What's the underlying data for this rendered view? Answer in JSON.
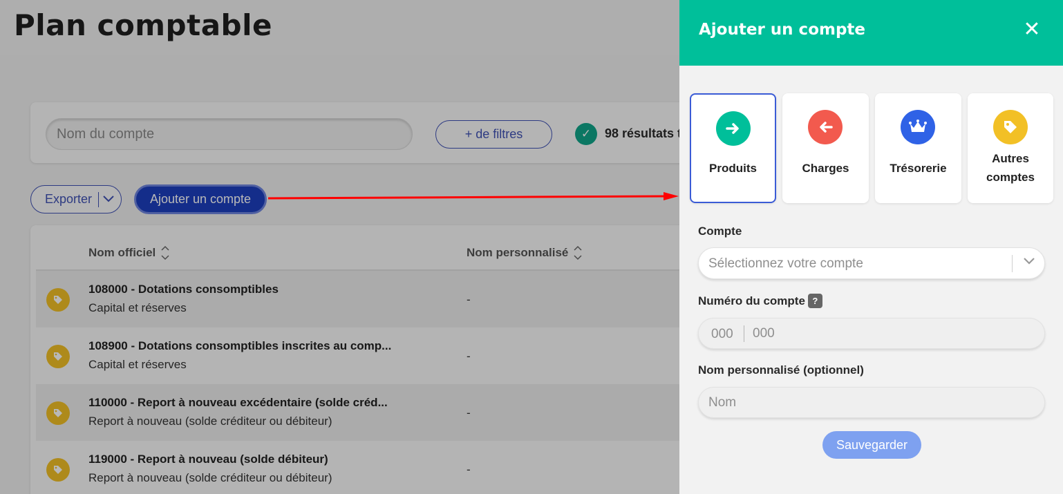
{
  "page": {
    "title": "Plan comptable",
    "search_placeholder": "Nom du compte",
    "filters_label": "+ de filtres",
    "results_text": "98 résultats t",
    "export_label": "Exporter",
    "add_account_label": "Ajouter un compte"
  },
  "table": {
    "columns": [
      "Nom officiel",
      "Nom personnalisé"
    ],
    "rows": [
      {
        "title": "108000 - Dotations consomptibles",
        "category": "Capital et réserves",
        "custom_name": "-"
      },
      {
        "title": "108900 - Dotations consomptibles inscrites au comp...",
        "category": "Capital et réserves",
        "custom_name": "-"
      },
      {
        "title": "110000 - Report à nouveau excédentaire (solde créd...",
        "category": "Report à nouveau (solde créditeur ou débiteur)",
        "custom_name": "-"
      },
      {
        "title": "119000 - Report à nouveau (solde débiteur)",
        "category": "Report à nouveau (solde créditeur ou débiteur)",
        "custom_name": "-"
      }
    ]
  },
  "panel": {
    "title": "Ajouter un compte",
    "close_icon": "close-icon",
    "types": [
      {
        "label": "Produits",
        "icon": "arrow-right-icon",
        "color": "#00bf9a",
        "selected": true
      },
      {
        "label": "Charges",
        "icon": "arrow-left-icon",
        "color": "#f25a4e",
        "selected": false
      },
      {
        "label": "Trésorerie",
        "icon": "crown-icon",
        "color": "#2f62e6",
        "selected": false
      },
      {
        "label": "Autres comptes",
        "icon": "tag-icon",
        "color": "#f2c026",
        "selected": false
      }
    ],
    "account_label": "Compte",
    "account_placeholder": "Sélectionnez votre compte",
    "number_label": "Numéro du compte",
    "help_badge": "?",
    "number_prefix": "000",
    "number_placeholder": "000",
    "custom_name_label": "Nom personnalisé (optionnel)",
    "custom_name_placeholder": "Nom",
    "save_label": "Sauvegarder"
  },
  "colors": {
    "accent": "#00bf9a",
    "primary": "#1c3fc0",
    "annotation_arrow": "#ff0000"
  }
}
